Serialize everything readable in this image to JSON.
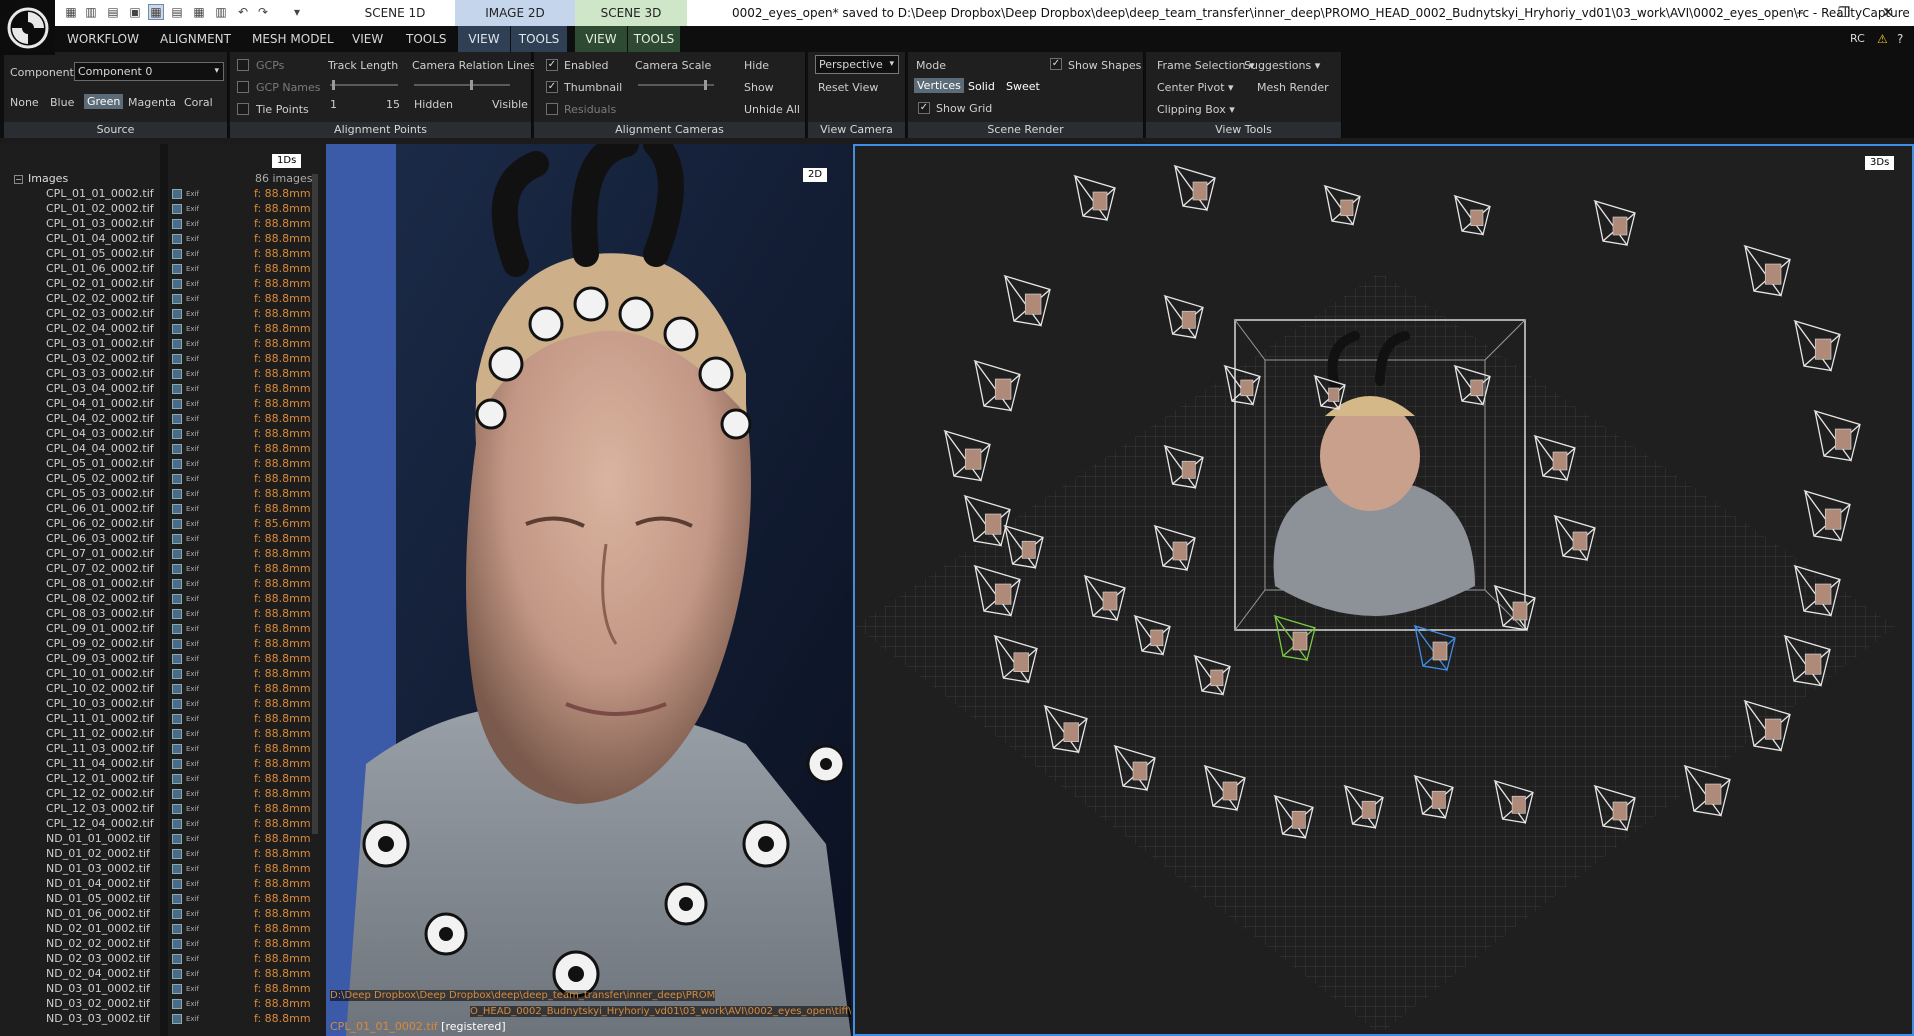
{
  "titlebar": {
    "title": "0002_eyes_open* saved to D:\\Deep Dropbox\\Deep Dropbox\\deep\\deep_team_transfer\\inner_deep\\PROMO_HEAD_0002_Budnytskyi_Hryhoriy_vd01\\03_work\\AVI\\0002_eyes_open\\rc - RealityCapture",
    "scene_tabs": [
      "SCENE 1D",
      "IMAGE 2D",
      "SCENE 3D"
    ]
  },
  "menu": {
    "items": [
      "WORKFLOW",
      "ALIGNMENT",
      "MESH MODEL",
      "VIEW",
      "TOOLS"
    ],
    "image_tabs": [
      "VIEW",
      "TOOLS"
    ],
    "scene_tabs": [
      "VIEW",
      "TOOLS"
    ],
    "rc_label": "RC"
  },
  "ribbon": {
    "source": {
      "component_label": "Component",
      "component_value": "Component 0",
      "colors": [
        "None",
        "Blue",
        "Green",
        "Magenta",
        "Coral"
      ],
      "label": "Source"
    },
    "alignment_points": {
      "gcps": "GCPs",
      "gcp_names": "GCP Names",
      "tie_points": "Tie Points",
      "track_length": "Track Length",
      "track_min": "1",
      "track_max": "15",
      "relation_lines": "Camera Relation Lines",
      "hidden": "Hidden",
      "visible": "Visible",
      "label": "Alignment Points"
    },
    "alignment_cameras": {
      "enabled": "Enabled",
      "thumbnail": "Thumbnail",
      "residuals": "Residuals",
      "camera_scale": "Camera Scale",
      "hide": "Hide",
      "show": "Show",
      "unhide_all": "Unhide All",
      "label": "Alignment Cameras"
    },
    "view_camera": {
      "projection": "Perspective",
      "reset_view": "Reset View",
      "label": "View Camera"
    },
    "scene_render": {
      "mode": "Mode",
      "vertices": "Vertices",
      "solid": "Solid",
      "sweet": "Sweet",
      "show_grid": "Show Grid",
      "show_shapes": "Show Shapes",
      "label": "Scene Render"
    },
    "view_tools": {
      "frame_selection": "Frame Selection",
      "suggestions": "Suggestions",
      "center_pivot": "Center Pivot",
      "mesh_render": "Mesh Render",
      "clipping_box": "Clipping Box",
      "label": "View Tools"
    }
  },
  "images_panel": {
    "badge": "1Ds",
    "root": "Images",
    "count": "86 images",
    "items": [
      {
        "name": "CPL_01_01_0002.tif",
        "f": "f: 88.8mm"
      },
      {
        "name": "CPL_01_02_0002.tif",
        "f": "f: 88.8mm"
      },
      {
        "name": "CPL_01_03_0002.tif",
        "f": "f: 88.8mm"
      },
      {
        "name": "CPL_01_04_0002.tif",
        "f": "f: 88.8mm"
      },
      {
        "name": "CPL_01_05_0002.tif",
        "f": "f: 88.8mm"
      },
      {
        "name": "CPL_01_06_0002.tif",
        "f": "f: 88.8mm"
      },
      {
        "name": "CPL_02_01_0002.tif",
        "f": "f: 88.8mm"
      },
      {
        "name": "CPL_02_02_0002.tif",
        "f": "f: 88.8mm"
      },
      {
        "name": "CPL_02_03_0002.tif",
        "f": "f: 88.8mm"
      },
      {
        "name": "CPL_02_04_0002.tif",
        "f": "f: 88.8mm"
      },
      {
        "name": "CPL_03_01_0002.tif",
        "f": "f: 88.8mm"
      },
      {
        "name": "CPL_03_02_0002.tif",
        "f": "f: 88.8mm"
      },
      {
        "name": "CPL_03_03_0002.tif",
        "f": "f: 88.8mm"
      },
      {
        "name": "CPL_03_04_0002.tif",
        "f": "f: 88.8mm"
      },
      {
        "name": "CPL_04_01_0002.tif",
        "f": "f: 88.8mm"
      },
      {
        "name": "CPL_04_02_0002.tif",
        "f": "f: 88.8mm"
      },
      {
        "name": "CPL_04_03_0002.tif",
        "f": "f: 88.8mm"
      },
      {
        "name": "CPL_04_04_0002.tif",
        "f": "f: 88.8mm"
      },
      {
        "name": "CPL_05_01_0002.tif",
        "f": "f: 88.8mm"
      },
      {
        "name": "CPL_05_02_0002.tif",
        "f": "f: 88.8mm"
      },
      {
        "name": "CPL_05_03_0002.tif",
        "f": "f: 88.8mm"
      },
      {
        "name": "CPL_06_01_0002.tif",
        "f": "f: 88.8mm"
      },
      {
        "name": "CPL_06_02_0002.tif",
        "f": "f: 85.6mm"
      },
      {
        "name": "CPL_06_03_0002.tif",
        "f": "f: 88.8mm"
      },
      {
        "name": "CPL_07_01_0002.tif",
        "f": "f: 88.8mm"
      },
      {
        "name": "CPL_07_02_0002.tif",
        "f": "f: 88.8mm"
      },
      {
        "name": "CPL_08_01_0002.tif",
        "f": "f: 88.8mm"
      },
      {
        "name": "CPL_08_02_0002.tif",
        "f": "f: 88.8mm"
      },
      {
        "name": "CPL_08_03_0002.tif",
        "f": "f: 88.8mm"
      },
      {
        "name": "CPL_09_01_0002.tif",
        "f": "f: 88.8mm"
      },
      {
        "name": "CPL_09_02_0002.tif",
        "f": "f: 88.8mm"
      },
      {
        "name": "CPL_09_03_0002.tif",
        "f": "f: 88.8mm"
      },
      {
        "name": "CPL_10_01_0002.tif",
        "f": "f: 88.8mm"
      },
      {
        "name": "CPL_10_02_0002.tif",
        "f": "f: 88.8mm"
      },
      {
        "name": "CPL_10_03_0002.tif",
        "f": "f: 88.8mm"
      },
      {
        "name": "CPL_11_01_0002.tif",
        "f": "f: 88.8mm"
      },
      {
        "name": "CPL_11_02_0002.tif",
        "f": "f: 88.8mm"
      },
      {
        "name": "CPL_11_03_0002.tif",
        "f": "f: 88.8mm"
      },
      {
        "name": "CPL_11_04_0002.tif",
        "f": "f: 88.8mm"
      },
      {
        "name": "CPL_12_01_0002.tif",
        "f": "f: 88.8mm"
      },
      {
        "name": "CPL_12_02_0002.tif",
        "f": "f: 88.8mm"
      },
      {
        "name": "CPL_12_03_0002.tif",
        "f": "f: 88.8mm"
      },
      {
        "name": "CPL_12_04_0002.tif",
        "f": "f: 88.8mm"
      },
      {
        "name": "ND_01_01_0002.tif",
        "f": "f: 88.8mm"
      },
      {
        "name": "ND_01_02_0002.tif",
        "f": "f: 88.8mm"
      },
      {
        "name": "ND_01_03_0002.tif",
        "f": "f: 88.8mm"
      },
      {
        "name": "ND_01_04_0002.tif",
        "f": "f: 88.8mm"
      },
      {
        "name": "ND_01_05_0002.tif",
        "f": "f: 88.8mm"
      },
      {
        "name": "ND_01_06_0002.tif",
        "f": "f: 88.8mm"
      },
      {
        "name": "ND_02_01_0002.tif",
        "f": "f: 88.8mm"
      },
      {
        "name": "ND_02_02_0002.tif",
        "f": "f: 88.8mm"
      },
      {
        "name": "ND_02_03_0002.tif",
        "f": "f: 88.8mm"
      },
      {
        "name": "ND_02_04_0002.tif",
        "f": "f: 88.8mm"
      },
      {
        "name": "ND_03_01_0002.tif",
        "f": "f: 88.8mm"
      },
      {
        "name": "ND_03_02_0002.tif",
        "f": "f: 88.8mm"
      },
      {
        "name": "ND_03_03_0002.tif",
        "f": "f: 88.8mm"
      }
    ]
  },
  "image_view": {
    "badge": "2D",
    "path_line1": "D:\\Deep Dropbox\\Deep Dropbox\\deep\\deep_team_transfer\\inner_deep\\PROM",
    "path_line2": "O_HEAD_0002_Budnytskyi_Hryhoriy_vd01\\03_work\\AVI\\0002_eyes_open\\tiff\\",
    "file": "CPL_01_01_0002.tif",
    "status": "[registered]"
  },
  "scene_view": {
    "badge": "3Ds"
  },
  "colors": {
    "accent_blue": "#3f8ee8",
    "focal_orange": "#d98a3a",
    "image_tab": "#2f3f54",
    "scene_tab": "#2f4a33"
  }
}
